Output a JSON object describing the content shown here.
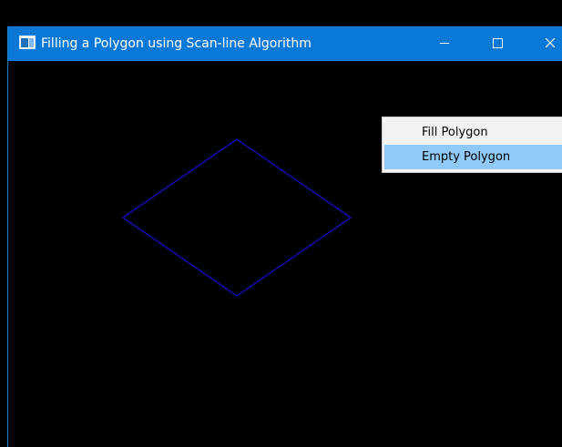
{
  "window": {
    "title": "Filling a Polygon using Scan-line Algorithm",
    "controls": {
      "minimize": "minimize-icon",
      "maximize": "maximize-icon",
      "close": "close-icon"
    }
  },
  "canvas": {
    "background": "#000000",
    "polygon": {
      "shape": "diamond",
      "stroke": "#1010c8",
      "filled": false
    }
  },
  "context_menu": {
    "items": [
      {
        "label": "Fill Polygon",
        "highlighted": false
      },
      {
        "label": "Empty Polygon",
        "highlighted": true
      }
    ],
    "highlight_color": "#91c9f7"
  },
  "colors": {
    "titlebar": "#0a78d7",
    "menu_background": "#f2f2f2"
  }
}
